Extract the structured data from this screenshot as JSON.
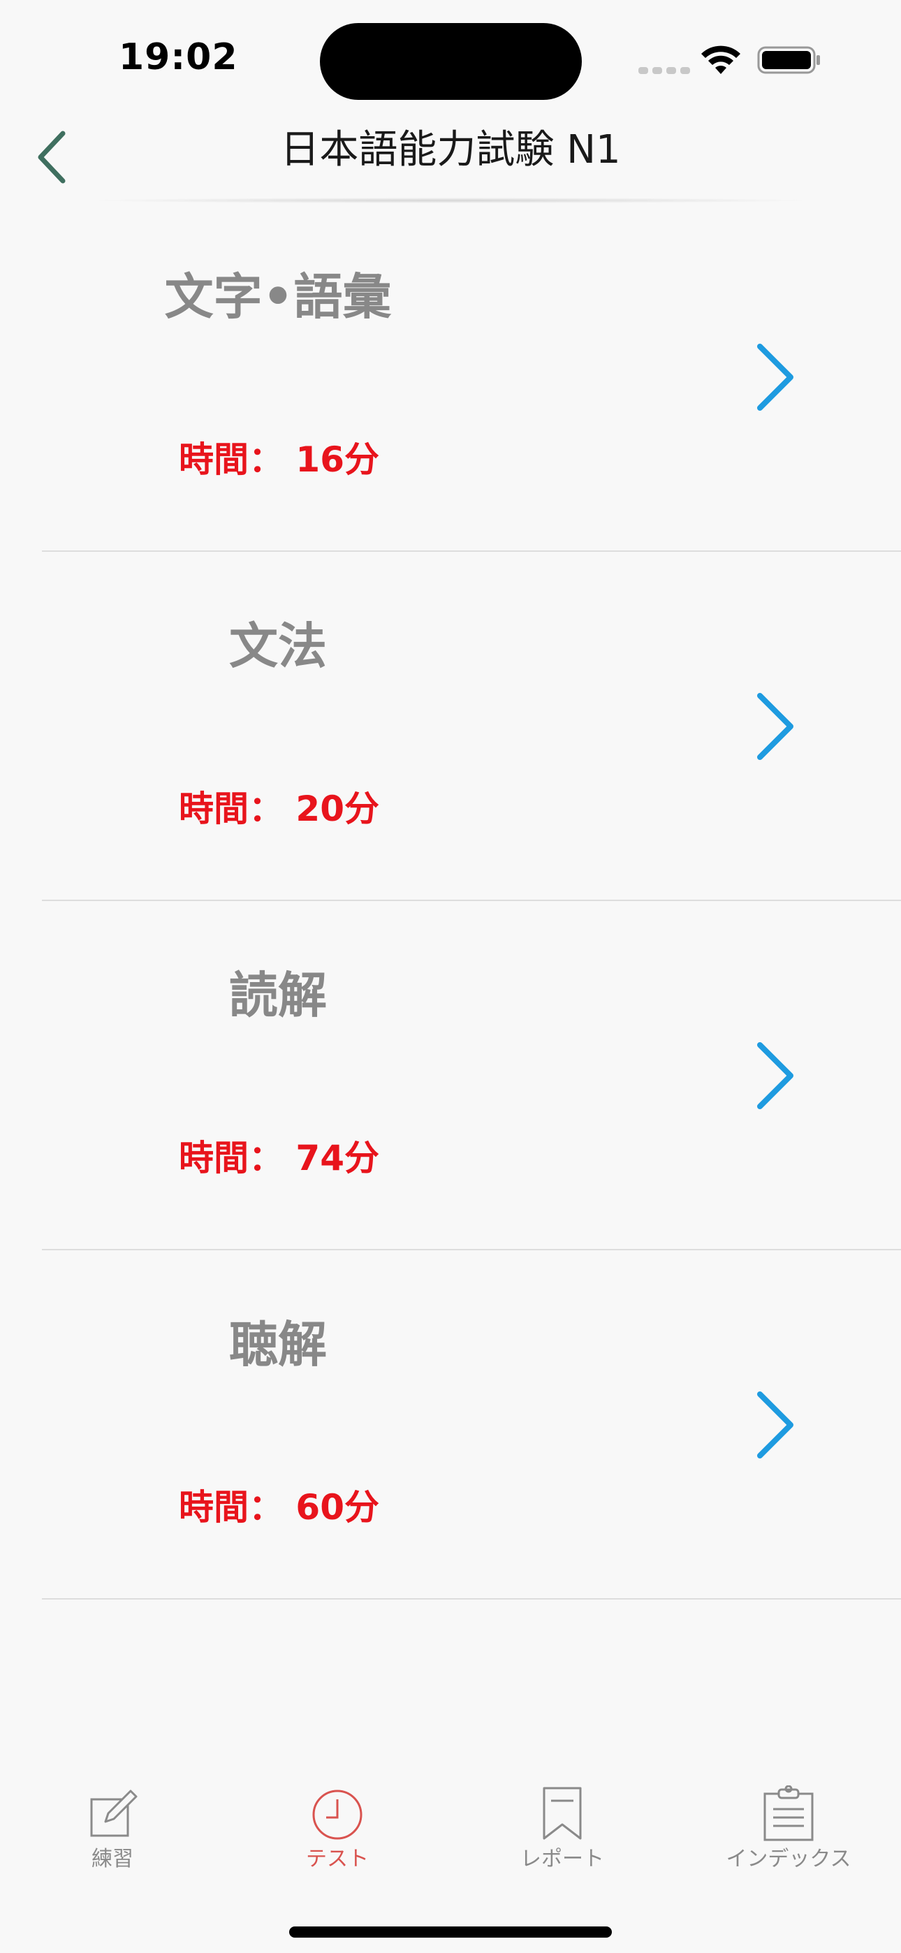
{
  "status_bar": {
    "time": "19:02"
  },
  "nav": {
    "title": "日本語能力試験 N1",
    "back_icon": "chevron-left-icon"
  },
  "colors": {
    "background": "#f8f8f8",
    "title_gray": "#888888",
    "time_red": "#e8141c",
    "chevron_blue": "#1e9be0",
    "back_green": "#3f6f5f",
    "tab_active": "#d9534f",
    "tab_inactive": "#8a8a8a"
  },
  "sections": [
    {
      "title": "文字•語彙",
      "time": "時間：  16分"
    },
    {
      "title": "文法",
      "time": "時間：  20分"
    },
    {
      "title": "読解",
      "time": "時間：  74分"
    },
    {
      "title": "聴解",
      "time": "時間：  60分"
    }
  ],
  "tabs": [
    {
      "label": "練習",
      "icon": "pencil-square-icon",
      "active": false
    },
    {
      "label": "テスト",
      "icon": "clock-icon",
      "active": true
    },
    {
      "label": "レポート",
      "icon": "bookmark-icon",
      "active": false
    },
    {
      "label": "インデックス",
      "icon": "clipboard-icon",
      "active": false
    }
  ]
}
